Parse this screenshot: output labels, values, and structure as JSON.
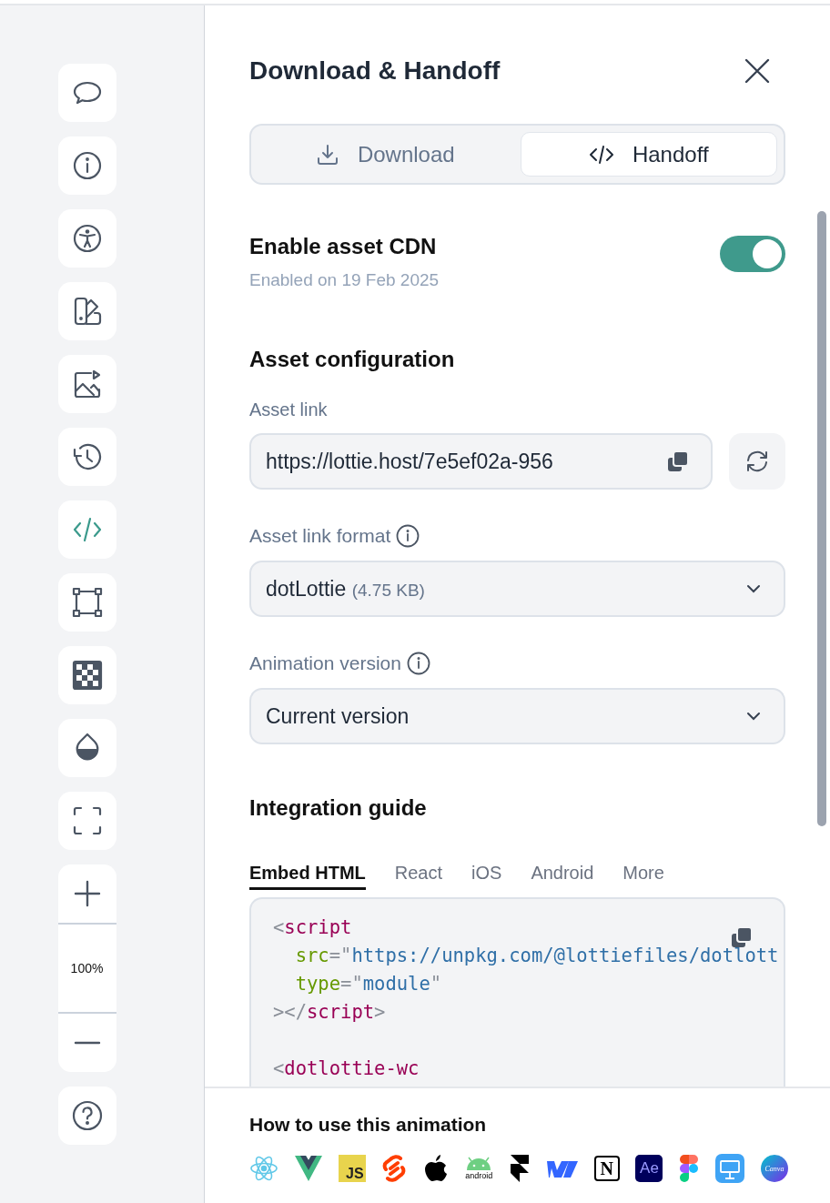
{
  "sidebar": {
    "tools": [
      {
        "kind": "comment",
        "selected": false
      },
      {
        "kind": "info",
        "selected": false
      },
      {
        "kind": "accessibility",
        "selected": false
      },
      {
        "kind": "swatches",
        "selected": false
      },
      {
        "kind": "image-play",
        "selected": false
      },
      {
        "kind": "history",
        "selected": false
      },
      {
        "kind": "code",
        "selected": true
      },
      {
        "kind": "transform",
        "selected": false
      },
      {
        "kind": "checker",
        "selected": false
      },
      {
        "kind": "drop",
        "selected": false
      },
      {
        "kind": "fullscreen",
        "selected": false
      }
    ],
    "zoom": {
      "level_text": "100%"
    }
  },
  "panel": {
    "title": "Download & Handoff",
    "tabs": [
      {
        "label": "Download",
        "kind": "download",
        "selected": false
      },
      {
        "label": "Handoff",
        "kind": "code",
        "selected": true
      }
    ],
    "cdn": {
      "title": "Enable asset CDN",
      "subtitle": "Enabled on 19 Feb 2025",
      "on": true
    },
    "config": {
      "title": "Asset configuration",
      "link_label": "Asset link",
      "link_value": "https://lottie.host/7e5ef02a-956",
      "format_label": "Asset link format",
      "format_value": "dotLottie",
      "format_size": "(4.75 KB)",
      "version_label": "Animation version",
      "version_value": "Current version"
    },
    "guide": {
      "title": "Integration guide",
      "tabs": [
        {
          "label": "Embed HTML",
          "selected": true
        },
        {
          "label": "React",
          "selected": false
        },
        {
          "label": "iOS",
          "selected": false
        },
        {
          "label": "Android",
          "selected": false
        },
        {
          "label": "More",
          "selected": false
        }
      ],
      "code_lines": [
        {
          "kind": "code",
          "tokens": [
            {
              "kind": "punct",
              "text": "<"
            },
            {
              "kind": "tag",
              "text": "script"
            }
          ]
        },
        {
          "kind": "code",
          "tokens": [
            {
              "kind": "attr",
              "text": "  src"
            },
            {
              "kind": "punct",
              "text": "=\""
            },
            {
              "kind": "string",
              "text": "https://unpkg.com/@lottiefiles/dotlott"
            }
          ]
        },
        {
          "kind": "code",
          "tokens": [
            {
              "kind": "attr",
              "text": "  type"
            },
            {
              "kind": "punct",
              "text": "=\""
            },
            {
              "kind": "string",
              "text": "module"
            },
            {
              "kind": "punct",
              "text": "\""
            }
          ]
        },
        {
          "kind": "code",
          "tokens": [
            {
              "kind": "punct",
              "text": "></"
            },
            {
              "kind": "tag",
              "text": "script"
            },
            {
              "kind": "punct",
              "text": ">"
            }
          ]
        },
        {
          "kind": "blank"
        },
        {
          "kind": "code",
          "tokens": [
            {
              "kind": "punct",
              "text": "<"
            },
            {
              "kind": "tag",
              "text": "dotlottie-wc"
            }
          ]
        }
      ]
    }
  },
  "footer": {
    "title": "How to use this animation",
    "integrations": [
      {
        "kind": "react"
      },
      {
        "kind": "vue"
      },
      {
        "kind": "js",
        "label": "JS"
      },
      {
        "kind": "svelte"
      },
      {
        "kind": "apple"
      },
      {
        "kind": "android",
        "label": "android"
      },
      {
        "kind": "framer"
      },
      {
        "kind": "webflow"
      },
      {
        "kind": "notion",
        "label": "N"
      },
      {
        "kind": "after-effects",
        "label": "Ae"
      },
      {
        "kind": "figma"
      },
      {
        "kind": "keynote"
      },
      {
        "kind": "canva",
        "label": "Canva"
      }
    ]
  }
}
